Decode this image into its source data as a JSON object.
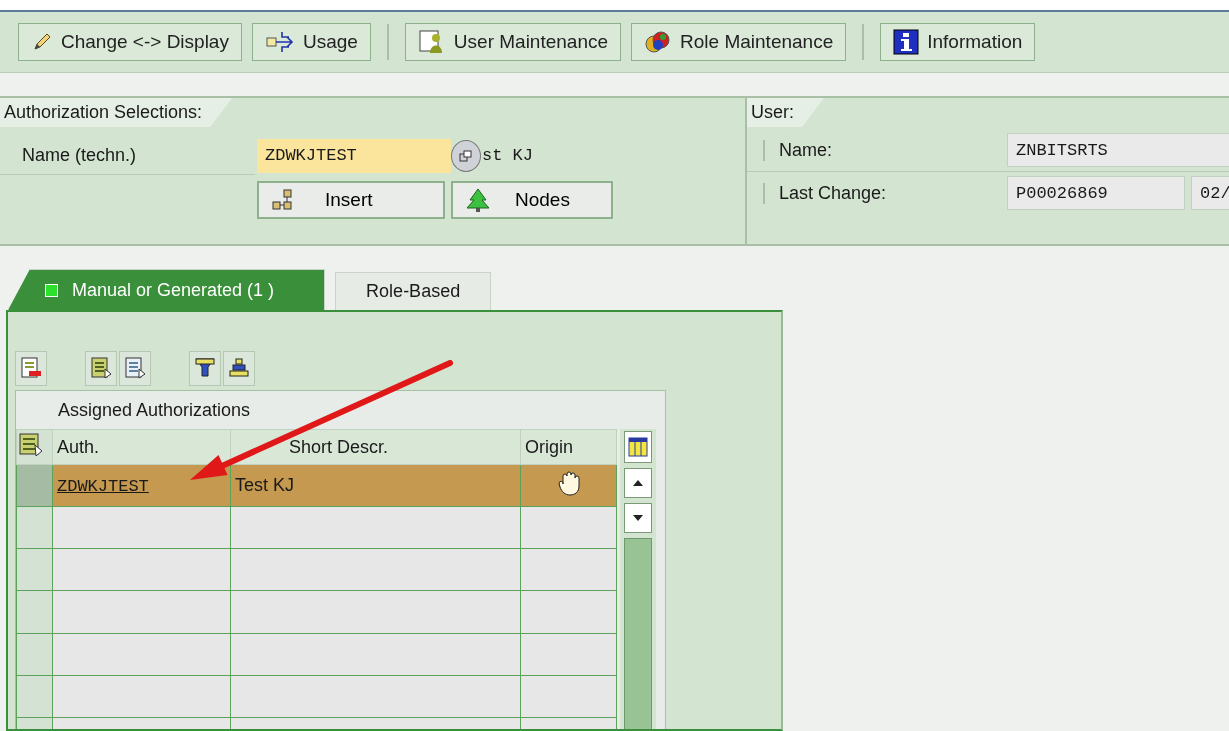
{
  "toolbar": {
    "groups": [
      [
        "Change <-> Display",
        "Usage"
      ],
      [
        "User Maintenance",
        "Role Maintenance"
      ],
      [
        "Information"
      ]
    ]
  },
  "authorization_selections": {
    "title": "Authorization Selections:",
    "name_label": "Name (techn.)",
    "name_value": "ZDWKJTEST",
    "description": "st KJ",
    "buttons": [
      "Insert",
      "Nodes"
    ]
  },
  "user": {
    "title": "User:",
    "fields": [
      {
        "label": "Name:",
        "values": [
          "ZNBITSRTS"
        ]
      },
      {
        "label": "Last Change:",
        "values": [
          "P00026869",
          "02/"
        ]
      }
    ]
  },
  "tabs": [
    {
      "label": "Manual or Generated (1 )",
      "selected": true
    },
    {
      "label": "Role-Based",
      "selected": false
    }
  ],
  "table": {
    "title": "Assigned Authorizations",
    "columns": [
      "Auth.",
      "Short Descr.",
      "Origin"
    ],
    "rows": [
      {
        "cells": [
          "ZDWKJTEST",
          "Test KJ"
        ],
        "selected": true
      }
    ]
  }
}
